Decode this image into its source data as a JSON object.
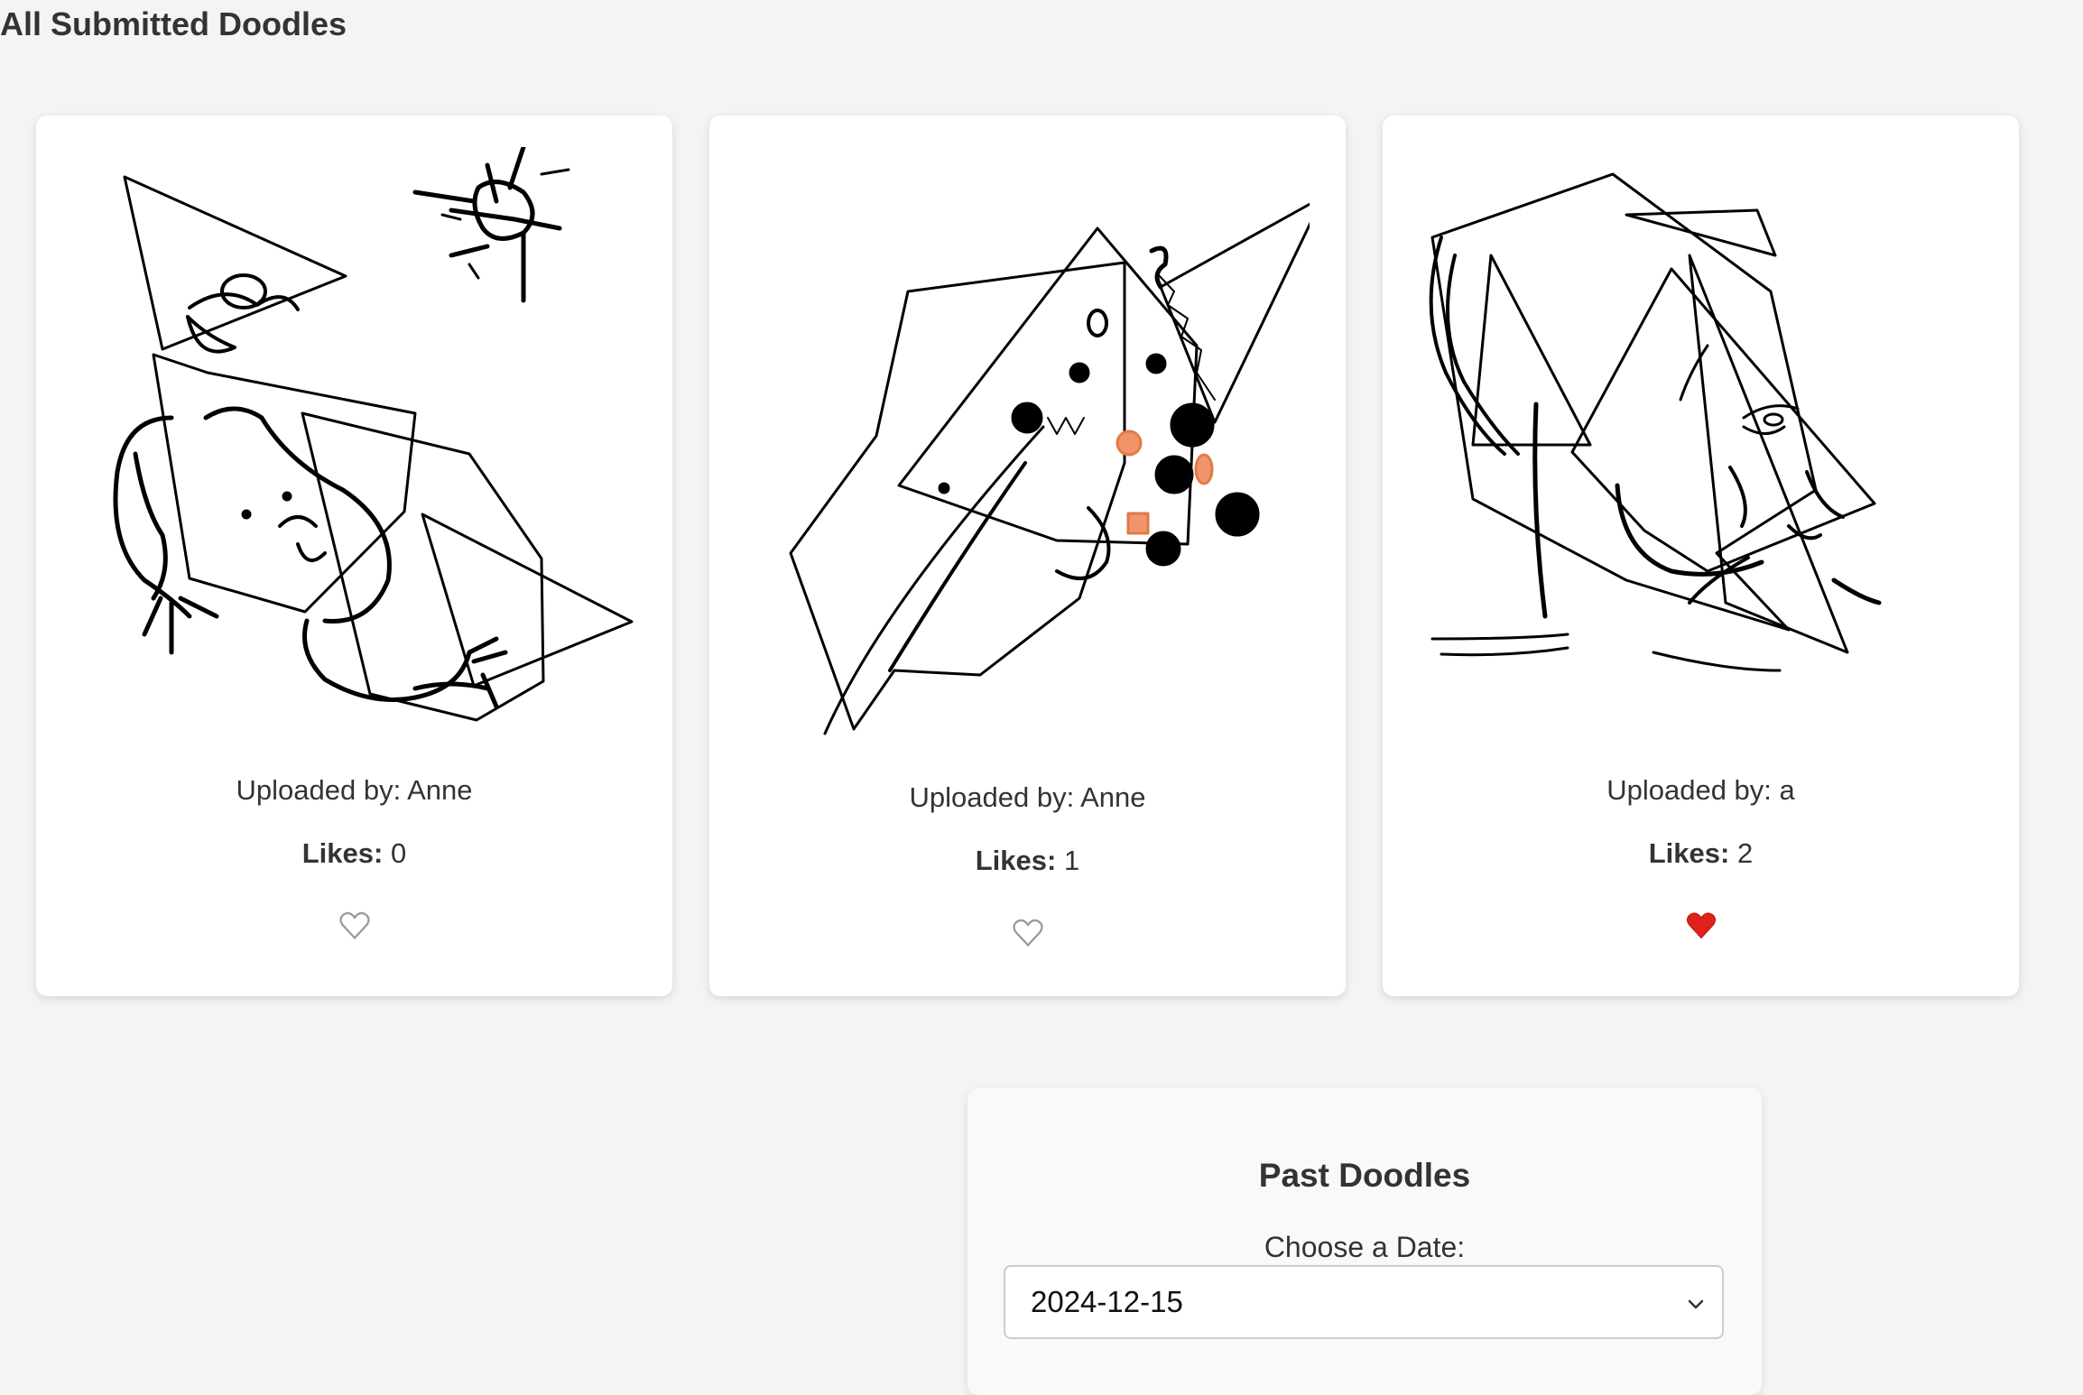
{
  "header": {
    "title": "All Submitted Doodles"
  },
  "doodles": [
    {
      "uploader_text": "Uploaded by: Anne",
      "likes_label": "Likes:",
      "likes_count": "0",
      "liked": false,
      "heart_icon": "heart-outline-icon"
    },
    {
      "uploader_text": "Uploaded by: Anne",
      "likes_label": "Likes:",
      "likes_count": "1",
      "liked": false,
      "heart_icon": "heart-outline-icon"
    },
    {
      "uploader_text": "Uploaded by: a",
      "likes_label": "Likes:",
      "likes_count": "2",
      "liked": true,
      "heart_icon": "heart-filled-icon"
    }
  ],
  "past": {
    "title": "Past Doodles",
    "date_label": "Choose a Date:",
    "selected_date": "2024-12-15"
  },
  "colors": {
    "background": "#f4f4f4",
    "card": "#ffffff",
    "heart_liked": "#e0201b",
    "accent_orange": "#f0956a"
  }
}
